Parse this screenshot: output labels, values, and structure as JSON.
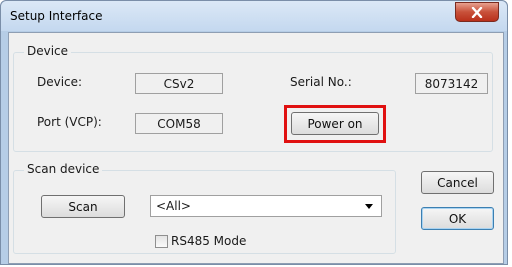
{
  "window": {
    "title": "Setup Interface",
    "close_symbol": "X"
  },
  "device_group": {
    "label": "Device",
    "device_label": "Device:",
    "device_value": "CSv2",
    "serial_label": "Serial No.:",
    "serial_value": "8073142",
    "port_label": "Port (VCP):",
    "port_value": "COM58",
    "power_button": "Power on"
  },
  "scan_group": {
    "label": "Scan device",
    "scan_button": "Scan",
    "filter_value": "<All>",
    "rs485_label": "RS485 Mode",
    "rs485_checked": false
  },
  "buttons": {
    "cancel": "Cancel",
    "ok": "OK"
  },
  "colors": {
    "highlight": "#e01010",
    "close_button": "#c8513a"
  }
}
